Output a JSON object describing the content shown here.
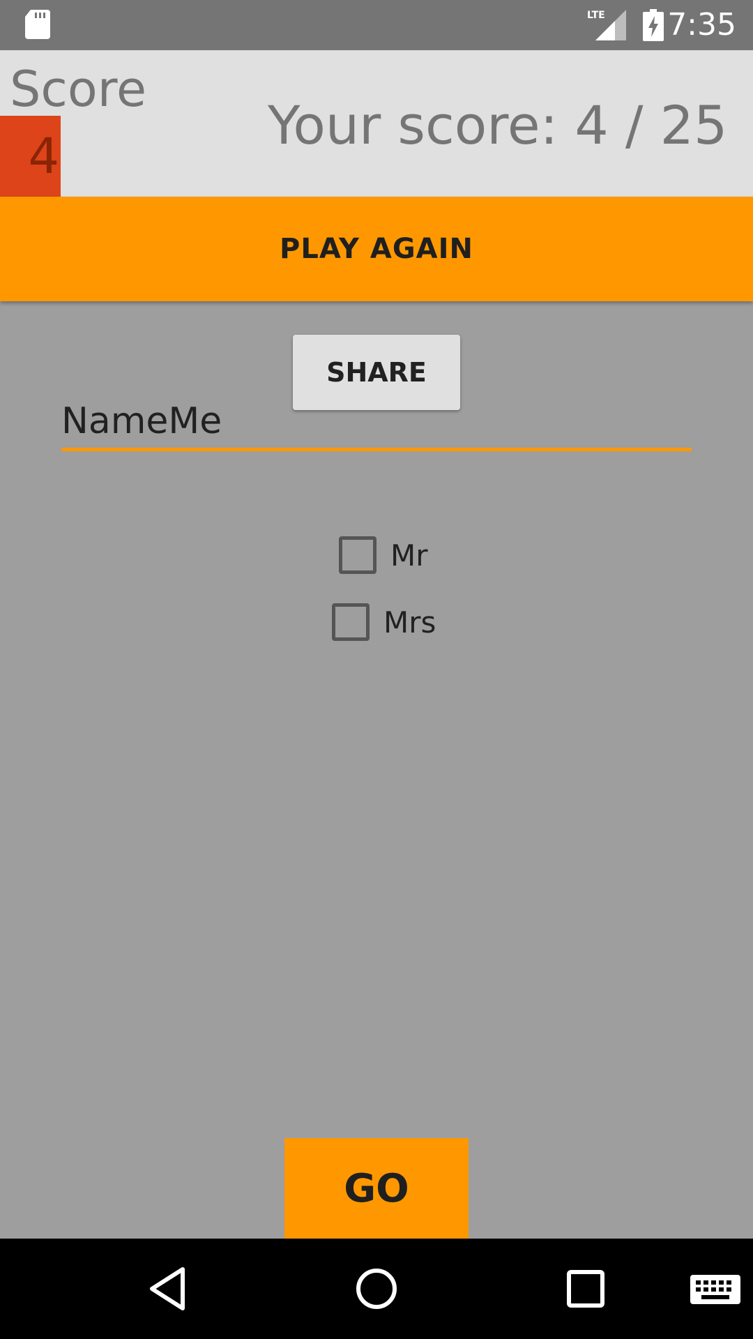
{
  "status_bar": {
    "network": "LTE",
    "time": "7:35"
  },
  "score_header": {
    "title": "Score",
    "score_value": "4",
    "summary": "Your score: 4 / 25"
  },
  "actions": {
    "play_again_label": "PLAY AGAIN",
    "share_label": "SHARE",
    "go_label": "GO"
  },
  "name_input": {
    "value": "NameMe"
  },
  "checkboxes": [
    {
      "label": "Mr",
      "checked": false
    },
    {
      "label": "Mrs",
      "checked": false
    }
  ],
  "colors": {
    "accent": "#ff9800",
    "score_badge": "#dd4419",
    "background": "#9e9e9e",
    "header": "#e0e0e0"
  }
}
